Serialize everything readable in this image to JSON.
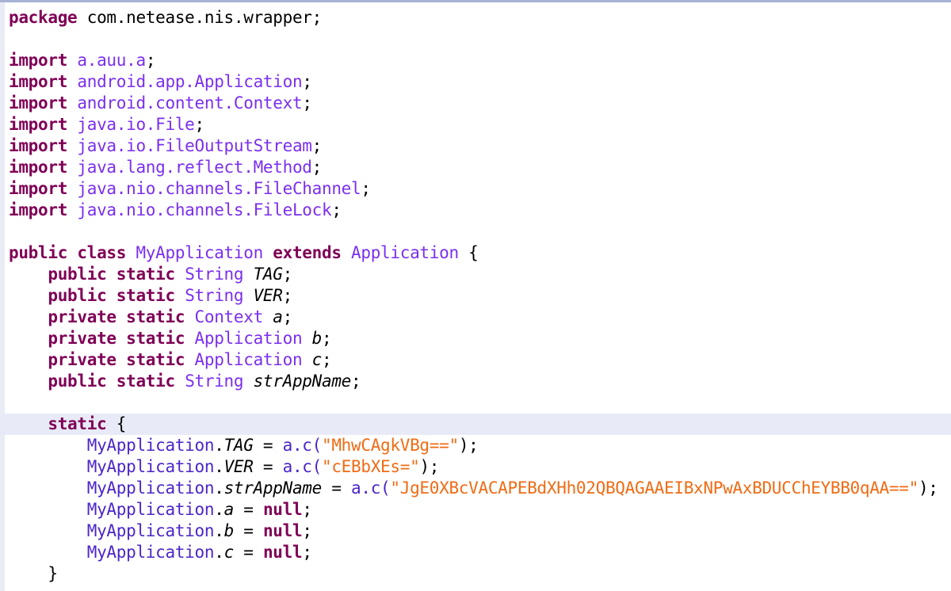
{
  "code": {
    "package_line": {
      "kw": "package",
      "name": "com.netease.nis.wrapper"
    },
    "imports": [
      {
        "kw": "import",
        "name": "a.auu.a"
      },
      {
        "kw": "import",
        "name": "android.app.Application"
      },
      {
        "kw": "import",
        "name": "android.content.Context"
      },
      {
        "kw": "import",
        "name": "java.io.File"
      },
      {
        "kw": "import",
        "name": "java.io.FileOutputStream"
      },
      {
        "kw": "import",
        "name": "java.lang.reflect.Method"
      },
      {
        "kw": "import",
        "name": "java.nio.channels.FileChannel"
      },
      {
        "kw": "import",
        "name": "java.nio.channels.FileLock"
      }
    ],
    "class_decl": {
      "kw1": "public",
      "kw2": "class",
      "name": "MyApplication",
      "kw3": "extends",
      "super": "Application",
      "brace": "{"
    },
    "fields": [
      {
        "mods": "public static",
        "type": "String",
        "name": "TAG"
      },
      {
        "mods": "public static",
        "type": "String",
        "name": "VER"
      },
      {
        "mods": "private static",
        "type": "Context",
        "name": "a"
      },
      {
        "mods": "private static",
        "type": "Application",
        "name": "b"
      },
      {
        "mods": "private static",
        "type": "Application",
        "name": "c"
      },
      {
        "mods": "public static",
        "type": "String",
        "name": "strAppName"
      }
    ],
    "static_block": {
      "kw": "static",
      "brace": "{",
      "close": "}",
      "assignments": [
        {
          "cls": "MyApplication",
          "field": "TAG",
          "call": "a.c(",
          "arg": "\"MhwCAgkVBg==\"",
          "end": ");"
        },
        {
          "cls": "MyApplication",
          "field": "VER",
          "call": "a.c(",
          "arg": "\"cEBbXEs=\"",
          "end": ");"
        },
        {
          "cls": "MyApplication",
          "field": "strAppName",
          "call": "a.c(",
          "arg": "\"JgE0XBcVACAPEBdXHh02QBQAGAAEIBxNPwAxBDUCChEYBB0qAA==\"",
          "end": ");"
        },
        {
          "cls": "MyApplication",
          "field": "a",
          "value": "null",
          "end": ";"
        },
        {
          "cls": "MyApplication",
          "field": "b",
          "value": "null",
          "end": ";"
        },
        {
          "cls": "MyApplication",
          "field": "c",
          "value": "null",
          "end": ";"
        }
      ]
    }
  },
  "colors": {
    "keyword": "#7f0055",
    "type": "#7a2ff0",
    "string": "#f06b14",
    "current_line": "#e8ebf7"
  }
}
